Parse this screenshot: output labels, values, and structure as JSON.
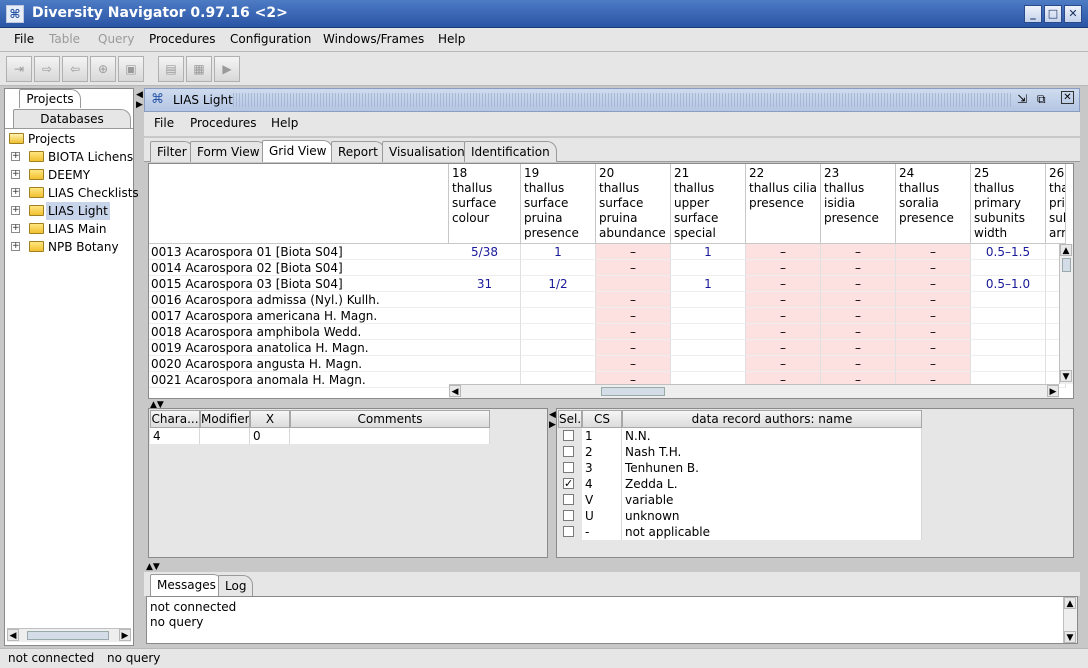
{
  "window": {
    "title": "Diversity Navigator 0.97.16 <2>"
  },
  "menubar": [
    {
      "label": "File",
      "enabled": true
    },
    {
      "label": "Table",
      "enabled": false
    },
    {
      "label": "Query",
      "enabled": false
    },
    {
      "label": "Procedures",
      "enabled": true
    },
    {
      "label": "Configuration",
      "enabled": true
    },
    {
      "label": "Windows/Frames",
      "enabled": true
    },
    {
      "label": "Help",
      "enabled": true
    }
  ],
  "left_tabs": {
    "projects": "Projects",
    "databases": "Databases"
  },
  "tree": {
    "root": "Projects",
    "items": [
      "BIOTA Lichens",
      "DEEMY",
      "LIAS Checklists",
      "LIAS Light",
      "LIAS Main",
      "NPB Botany"
    ],
    "selected": "LIAS Light"
  },
  "inner_window": {
    "title": "LIAS Light"
  },
  "inner_menubar": [
    "File",
    "Procedures",
    "Help"
  ],
  "inner_tabs": [
    "Filter",
    "Form View",
    "Grid View",
    "Report",
    "Visualisation",
    "Identification"
  ],
  "active_inner_tab": "Grid View",
  "grid": {
    "columns": [
      {
        "num": "18",
        "label": "thallus surface colour"
      },
      {
        "num": "19",
        "label": "thallus surface pruina presence"
      },
      {
        "num": "20",
        "label": "thallus surface pruina abundance"
      },
      {
        "num": "21",
        "label": "thallus upper surface special"
      },
      {
        "num": "22",
        "label": "thallus cilia presence"
      },
      {
        "num": "23",
        "label": "thallus isidia presence"
      },
      {
        "num": "24",
        "label": "thallus soralia presence"
      },
      {
        "num": "25",
        "label": "thallus primary subunits width"
      },
      {
        "num": "26",
        "label": "thallus primary subunits arrangement"
      }
    ],
    "rows": [
      {
        "name": "0013 Acarospora 01 [Biota S04]",
        "cells": [
          "5/38",
          "1",
          "–",
          "1",
          "–",
          "–",
          "–",
          "0.5–1.5",
          ""
        ]
      },
      {
        "name": "0014 Acarospora 02 [Biota S04]",
        "cells": [
          "",
          "",
          "–",
          "",
          "–",
          "–",
          "–",
          "",
          ""
        ]
      },
      {
        "name": "0015 Acarospora 03 [Biota S04]",
        "cells": [
          "31",
          "1/2",
          "",
          "1",
          "–",
          "–",
          "–",
          "0.5–1.0",
          ""
        ]
      },
      {
        "name": "0016 Acarospora admissa (Nyl.) Kullh.",
        "cells": [
          "",
          "",
          "–",
          "",
          "–",
          "–",
          "–",
          "",
          ""
        ]
      },
      {
        "name": "0017 Acarospora americana H. Magn.",
        "cells": [
          "",
          "",
          "–",
          "",
          "–",
          "–",
          "–",
          "",
          ""
        ]
      },
      {
        "name": "0018 Acarospora amphibola Wedd.",
        "cells": [
          "",
          "",
          "–",
          "",
          "–",
          "–",
          "–",
          "",
          ""
        ]
      },
      {
        "name": "0019 Acarospora anatolica H. Magn.",
        "cells": [
          "",
          "",
          "–",
          "",
          "–",
          "–",
          "–",
          "",
          ""
        ]
      },
      {
        "name": "0020 Acarospora angusta H. Magn.",
        "cells": [
          "",
          "",
          "–",
          "",
          "–",
          "–",
          "–",
          "",
          ""
        ]
      },
      {
        "name": "0021 Acarospora anomala H. Magn.",
        "cells": [
          "",
          "",
          "–",
          "",
          "–",
          "–",
          "–",
          "",
          ""
        ]
      }
    ]
  },
  "char_table": {
    "headers": [
      "Chara...",
      "Modifier",
      "X",
      "Comments"
    ],
    "row": [
      "4",
      "",
      "0",
      ""
    ]
  },
  "cs_table": {
    "headers": [
      "Sel.",
      "CS",
      "data record authors: name"
    ],
    "rows": [
      {
        "checked": false,
        "cs": "1",
        "name": "N.N."
      },
      {
        "checked": false,
        "cs": "2",
        "name": "Nash T.H."
      },
      {
        "checked": false,
        "cs": "3",
        "name": "Tenhunen B."
      },
      {
        "checked": true,
        "cs": "4",
        "name": "Zedda L."
      },
      {
        "checked": false,
        "cs": "V",
        "name": "variable"
      },
      {
        "checked": false,
        "cs": "U",
        "name": "unknown"
      },
      {
        "checked": false,
        "cs": "-",
        "name": "not applicable"
      }
    ]
  },
  "message_tabs": [
    "Messages",
    "Log"
  ],
  "messages": [
    "not connected",
    "no query"
  ],
  "status": {
    "connection": "not connected",
    "query": "no query"
  }
}
